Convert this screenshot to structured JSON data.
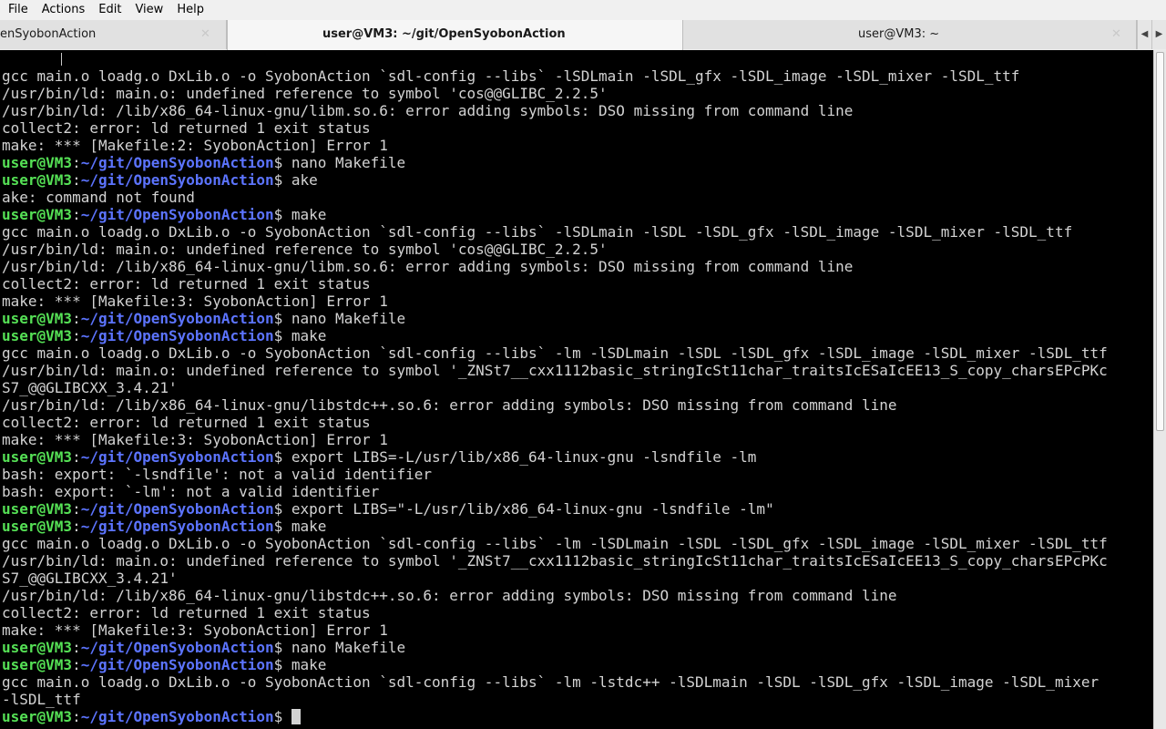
{
  "menubar": {
    "items": [
      "File",
      "Actions",
      "Edit",
      "View",
      "Help"
    ]
  },
  "tabs": [
    {
      "label": "enSyobonAction",
      "close": "✕",
      "active": false
    },
    {
      "label": "user@VM3: ~/git/OpenSyobonAction",
      "close": "",
      "active": true
    },
    {
      "label": "user@VM3: ~",
      "close": "✕",
      "active": false
    }
  ],
  "tab_scroll": {
    "left": "◀",
    "right": "▶"
  },
  "terminal": {
    "top_caret": "^",
    "prompt_user": "user@VM3",
    "prompt_sep": ":",
    "prompt_path": "~/git/OpenSyobonAction",
    "prompt_end": "$ ",
    "lines": [
      {
        "type": "out",
        "text": ""
      },
      {
        "type": "out",
        "text": "gcc main.o loadg.o DxLib.o -o SyobonAction `sdl-config --libs` -lSDLmain -lSDL_gfx -lSDL_image -lSDL_mixer -lSDL_ttf"
      },
      {
        "type": "out",
        "text": "/usr/bin/ld: main.o: undefined reference to symbol 'cos@@GLIBC_2.2.5'"
      },
      {
        "type": "out",
        "text": "/usr/bin/ld: /lib/x86_64-linux-gnu/libm.so.6: error adding symbols: DSO missing from command line"
      },
      {
        "type": "out",
        "text": "collect2: error: ld returned 1 exit status"
      },
      {
        "type": "out",
        "text": "make: *** [Makefile:2: SyobonAction] Error 1"
      },
      {
        "type": "cmd",
        "text": "nano Makefile"
      },
      {
        "type": "cmd",
        "text": "ake"
      },
      {
        "type": "out",
        "text": "ake: command not found"
      },
      {
        "type": "cmd",
        "text": "make"
      },
      {
        "type": "out",
        "text": "gcc main.o loadg.o DxLib.o -o SyobonAction `sdl-config --libs` -lSDLmain -lSDL -lSDL_gfx -lSDL_image -lSDL_mixer -lSDL_ttf"
      },
      {
        "type": "out",
        "text": "/usr/bin/ld: main.o: undefined reference to symbol 'cos@@GLIBC_2.2.5'"
      },
      {
        "type": "out",
        "text": "/usr/bin/ld: /lib/x86_64-linux-gnu/libm.so.6: error adding symbols: DSO missing from command line"
      },
      {
        "type": "out",
        "text": "collect2: error: ld returned 1 exit status"
      },
      {
        "type": "out",
        "text": "make: *** [Makefile:3: SyobonAction] Error 1"
      },
      {
        "type": "cmd",
        "text": "nano Makefile"
      },
      {
        "type": "cmd",
        "text": "make"
      },
      {
        "type": "out",
        "text": "gcc main.o loadg.o DxLib.o -o SyobonAction `sdl-config --libs` -lm -lSDLmain -lSDL -lSDL_gfx -lSDL_image -lSDL_mixer -lSDL_ttf"
      },
      {
        "type": "out",
        "text": "/usr/bin/ld: main.o: undefined reference to symbol '_ZNSt7__cxx1112basic_stringIcSt11char_traitsIcESaIcEE13_S_copy_charsEPcPKc"
      },
      {
        "type": "out",
        "text": "S7_@@GLIBCXX_3.4.21'"
      },
      {
        "type": "out",
        "text": "/usr/bin/ld: /lib/x86_64-linux-gnu/libstdc++.so.6: error adding symbols: DSO missing from command line"
      },
      {
        "type": "out",
        "text": "collect2: error: ld returned 1 exit status"
      },
      {
        "type": "out",
        "text": "make: *** [Makefile:3: SyobonAction] Error 1"
      },
      {
        "type": "cmd",
        "text": "export LIBS=-L/usr/lib/x86_64-linux-gnu -lsndfile -lm"
      },
      {
        "type": "out",
        "text": "bash: export: `-lsndfile': not a valid identifier"
      },
      {
        "type": "out",
        "text": "bash: export: `-lm': not a valid identifier"
      },
      {
        "type": "cmd",
        "text": "export LIBS=\"-L/usr/lib/x86_64-linux-gnu -lsndfile -lm\""
      },
      {
        "type": "cmd",
        "text": "make"
      },
      {
        "type": "out",
        "text": "gcc main.o loadg.o DxLib.o -o SyobonAction `sdl-config --libs` -lm -lSDLmain -lSDL -lSDL_gfx -lSDL_image -lSDL_mixer -lSDL_ttf"
      },
      {
        "type": "out",
        "text": "/usr/bin/ld: main.o: undefined reference to symbol '_ZNSt7__cxx1112basic_stringIcSt11char_traitsIcESaIcEE13_S_copy_charsEPcPKc"
      },
      {
        "type": "out",
        "text": "S7_@@GLIBCXX_3.4.21'"
      },
      {
        "type": "out",
        "text": "/usr/bin/ld: /lib/x86_64-linux-gnu/libstdc++.so.6: error adding symbols: DSO missing from command line"
      },
      {
        "type": "out",
        "text": "collect2: error: ld returned 1 exit status"
      },
      {
        "type": "out",
        "text": "make: *** [Makefile:3: SyobonAction] Error 1"
      },
      {
        "type": "cmd",
        "text": "nano Makefile"
      },
      {
        "type": "cmd",
        "text": "make"
      },
      {
        "type": "out",
        "text": "gcc main.o loadg.o DxLib.o -o SyobonAction `sdl-config --libs` -lm -lstdc++ -lSDLmain -lSDL -lSDL_gfx -lSDL_image -lSDL_mixer"
      },
      {
        "type": "out",
        "text": "-lSDL_ttf"
      },
      {
        "type": "prompt",
        "text": ""
      }
    ]
  }
}
